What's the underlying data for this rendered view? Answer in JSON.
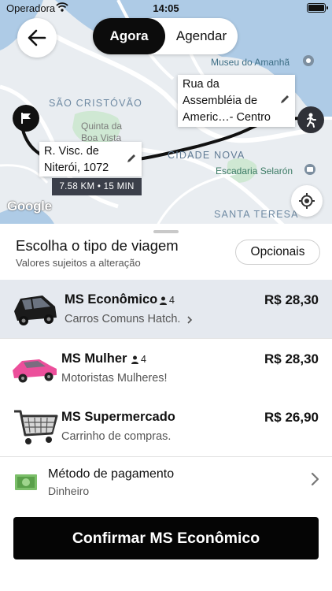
{
  "status_bar": {
    "carrier": "Operadora",
    "time": "14:05"
  },
  "map": {
    "tabs": [
      {
        "label": "Agora",
        "active": true
      },
      {
        "label": "Agendar",
        "active": false
      }
    ],
    "destination_callout": "Rua da Assembléia de Americ…- Centro",
    "origin_callout": "R. Visc. de Niterói, 1072",
    "eta": "7.58 KM • 15 MIN",
    "labels": {
      "sao_cristovao": "SÃO CRISTÓVÃO",
      "cidade_nova": "CIDADE NOVA",
      "santa_teresa": "SANTA TERESA",
      "museu": "Museu do Amanhã",
      "quinta": "Quinta da Boa Vista",
      "selaron": "Escadaria Selarón",
      "logo": "Google"
    },
    "colors": {
      "water": "#aecbe6",
      "land": "#e9edf1",
      "park": "#cfe8d3",
      "route": "#111111"
    }
  },
  "sheet": {
    "title": "Escolha o tipo de viagem",
    "subtitle": "Valores sujeitos a alteração",
    "options_button": "Opcionais",
    "rides": [
      {
        "name": "MS Econômico",
        "seats": "4",
        "description": "Carros Comuns Hatch.",
        "price": "R$ 28,30",
        "selected": true,
        "icon": "black-car-icon"
      },
      {
        "name": "MS Mulher",
        "seats": "4",
        "description": "Motoristas Mulheres!",
        "price": "R$ 28,30",
        "selected": false,
        "icon": "pink-car-icon"
      },
      {
        "name": "MS Supermercado",
        "seats": "",
        "description": "Carrinho de compras.",
        "price": "R$ 26,90",
        "selected": false,
        "icon": "shopping-cart-icon"
      }
    ],
    "payment": {
      "title": "Método de pagamento",
      "value": "Dinheiro",
      "icon": "cash-icon"
    },
    "confirm_button": "Confirmar MS Econômico"
  }
}
